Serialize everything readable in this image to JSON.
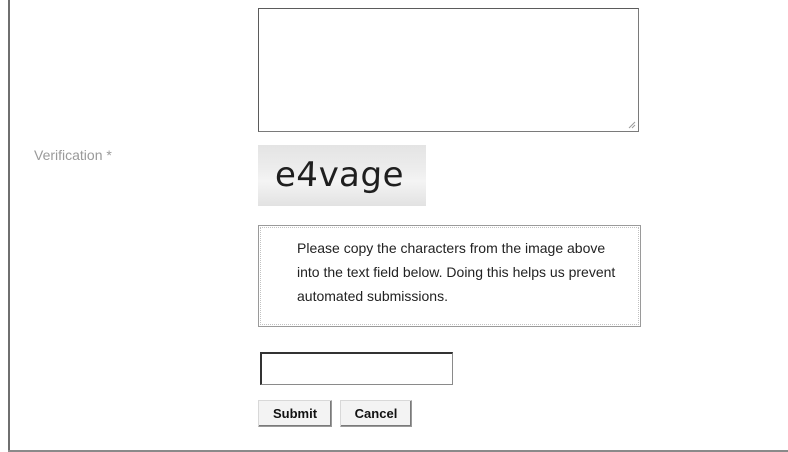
{
  "form": {
    "comment_value": "",
    "verification_label": "Verification *",
    "captcha_image_text": "e4vage",
    "captcha_help": "Please copy the characters from the image above into the text field below. Doing this helps us prevent automated submissions.",
    "captcha_input_value": "",
    "submit_label": "Submit",
    "cancel_label": "Cancel"
  }
}
